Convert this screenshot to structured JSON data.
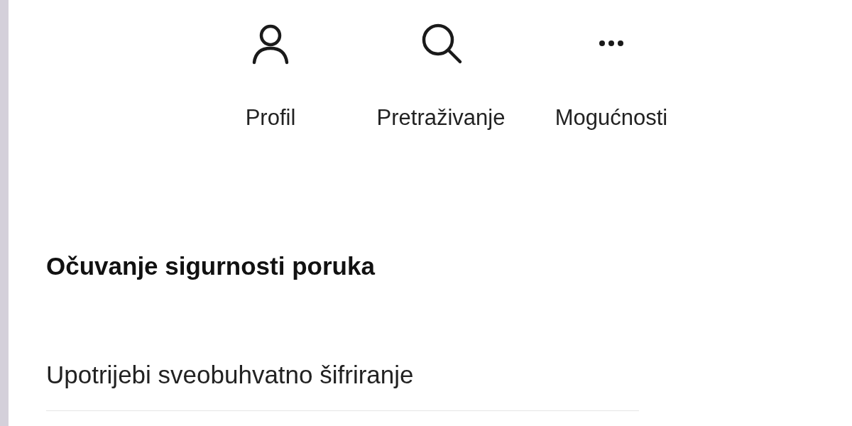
{
  "actions": [
    {
      "kind": "profile",
      "label": "Profil"
    },
    {
      "kind": "search",
      "label": "Pretraživanje"
    },
    {
      "kind": "more",
      "label": "Mogućnosti"
    }
  ],
  "section": {
    "title": "Očuvanje sigurnosti poruka",
    "items": [
      "Upotrijebi sveobuhvatno šifriranje"
    ]
  }
}
